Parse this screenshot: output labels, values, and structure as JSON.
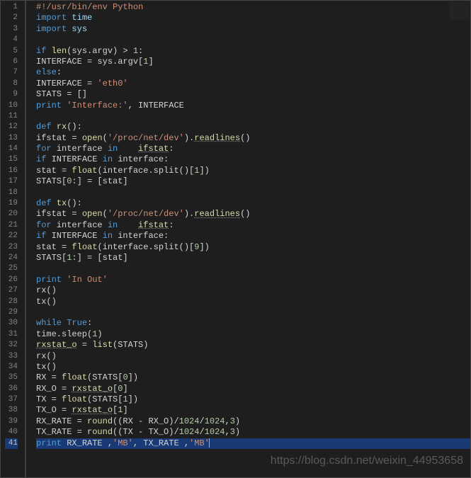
{
  "watermark": "https://blog.csdn.net/weixin_44953658",
  "active_line": 41,
  "lines": [
    {
      "n": 1,
      "tokens": [
        [
          "#!/usr/bin/env Python",
          "str"
        ]
      ]
    },
    {
      "n": 2,
      "tokens": [
        [
          "import",
          "kw"
        ],
        [
          " time",
          "var"
        ]
      ]
    },
    {
      "n": 3,
      "tokens": [
        [
          "import",
          "kw"
        ],
        [
          " sys",
          "var"
        ]
      ]
    },
    {
      "n": 4,
      "tokens": []
    },
    {
      "n": 5,
      "tokens": [
        [
          "if",
          "kw"
        ],
        [
          " ",
          "op"
        ],
        [
          "len",
          "fn"
        ],
        [
          "(sys.argv) > ",
          "op"
        ],
        [
          "1",
          "num"
        ],
        [
          ":",
          "op"
        ]
      ]
    },
    {
      "n": 6,
      "tokens": [
        [
          "INTERFACE = sys.argv[",
          "op"
        ],
        [
          "1",
          "num"
        ],
        [
          "]",
          "op"
        ]
      ]
    },
    {
      "n": 7,
      "tokens": [
        [
          "else",
          "kw"
        ],
        [
          ":",
          "op"
        ]
      ]
    },
    {
      "n": 8,
      "tokens": [
        [
          "INTERFACE = ",
          "op"
        ],
        [
          "'eth0'",
          "str"
        ]
      ]
    },
    {
      "n": 9,
      "tokens": [
        [
          "STATS = []",
          "op"
        ]
      ]
    },
    {
      "n": 10,
      "tokens": [
        [
          "print",
          "kw"
        ],
        [
          " ",
          "op"
        ],
        [
          "'Interface:'",
          "str"
        ],
        [
          ", INTERFACE",
          "op"
        ]
      ]
    },
    {
      "n": 11,
      "tokens": []
    },
    {
      "n": 12,
      "tokens": [
        [
          "def",
          "kw"
        ],
        [
          " ",
          "op"
        ],
        [
          "rx",
          "fn"
        ],
        [
          "():",
          "op"
        ]
      ]
    },
    {
      "n": 13,
      "tokens": [
        [
          "ifstat = ",
          "op"
        ],
        [
          "open",
          "fn"
        ],
        [
          "(",
          "op"
        ],
        [
          "'/proc/net/dev'",
          "str"
        ],
        [
          ").",
          "op"
        ],
        [
          "readlines",
          "fn ul"
        ],
        [
          "()",
          "op"
        ]
      ]
    },
    {
      "n": 14,
      "tokens": [
        [
          "for",
          "kw"
        ],
        [
          " interface ",
          "op"
        ],
        [
          "in",
          "kw"
        ],
        [
          "    ",
          "op"
        ],
        [
          "ifstat",
          "fn ul"
        ],
        [
          ":",
          "op"
        ]
      ]
    },
    {
      "n": 15,
      "tokens": [
        [
          "if",
          "kw"
        ],
        [
          " INTERFACE ",
          "op"
        ],
        [
          "in",
          "kw"
        ],
        [
          " interface:",
          "op"
        ]
      ]
    },
    {
      "n": 16,
      "tokens": [
        [
          "stat = ",
          "op"
        ],
        [
          "float",
          "fn"
        ],
        [
          "(interface.split()[",
          "op"
        ],
        [
          "1",
          "num"
        ],
        [
          "])",
          "op"
        ]
      ]
    },
    {
      "n": 17,
      "tokens": [
        [
          "STATS[",
          "op"
        ],
        [
          "0",
          "num"
        ],
        [
          ":] = [stat]",
          "op"
        ]
      ]
    },
    {
      "n": 18,
      "tokens": []
    },
    {
      "n": 19,
      "tokens": [
        [
          "def",
          "kw"
        ],
        [
          " ",
          "op"
        ],
        [
          "tx",
          "fn"
        ],
        [
          "():",
          "op"
        ]
      ]
    },
    {
      "n": 20,
      "tokens": [
        [
          "ifstat = ",
          "op"
        ],
        [
          "open",
          "fn"
        ],
        [
          "(",
          "op"
        ],
        [
          "'/proc/net/dev'",
          "str"
        ],
        [
          ").",
          "op"
        ],
        [
          "readlines",
          "fn ul"
        ],
        [
          "()",
          "op"
        ]
      ]
    },
    {
      "n": 21,
      "tokens": [
        [
          "for",
          "kw"
        ],
        [
          " interface ",
          "op"
        ],
        [
          "in",
          "kw"
        ],
        [
          "    ",
          "op"
        ],
        [
          "ifstat",
          "fn ul"
        ],
        [
          ":",
          "op"
        ]
      ]
    },
    {
      "n": 22,
      "tokens": [
        [
          "if",
          "kw"
        ],
        [
          " INTERFACE ",
          "op"
        ],
        [
          "in",
          "kw"
        ],
        [
          " interface:",
          "op"
        ]
      ]
    },
    {
      "n": 23,
      "tokens": [
        [
          "stat = ",
          "op"
        ],
        [
          "float",
          "fn"
        ],
        [
          "(interface.split()[",
          "op"
        ],
        [
          "9",
          "num"
        ],
        [
          "])",
          "op"
        ]
      ]
    },
    {
      "n": 24,
      "tokens": [
        [
          "STATS[",
          "op"
        ],
        [
          "1",
          "num"
        ],
        [
          ":] = [stat]",
          "op"
        ]
      ]
    },
    {
      "n": 25,
      "tokens": []
    },
    {
      "n": 26,
      "tokens": [
        [
          "print",
          "kw"
        ],
        [
          " ",
          "op"
        ],
        [
          "'In Out'",
          "str"
        ]
      ]
    },
    {
      "n": 27,
      "tokens": [
        [
          "rx()",
          "op"
        ]
      ]
    },
    {
      "n": 28,
      "tokens": [
        [
          "tx()",
          "op"
        ]
      ]
    },
    {
      "n": 29,
      "tokens": []
    },
    {
      "n": 30,
      "tokens": [
        [
          "while",
          "kw"
        ],
        [
          " ",
          "op"
        ],
        [
          "True",
          "kw"
        ],
        [
          ":",
          "op"
        ]
      ]
    },
    {
      "n": 31,
      "tokens": [
        [
          "time.sleep(",
          "op"
        ],
        [
          "1",
          "num"
        ],
        [
          ")",
          "op"
        ]
      ]
    },
    {
      "n": 32,
      "tokens": [
        [
          "rxstat_o",
          "fn ul"
        ],
        [
          " = ",
          "op"
        ],
        [
          "list",
          "fn"
        ],
        [
          "(STATS)",
          "op"
        ]
      ]
    },
    {
      "n": 33,
      "tokens": [
        [
          "rx()",
          "op"
        ]
      ]
    },
    {
      "n": 34,
      "tokens": [
        [
          "tx()",
          "op"
        ]
      ]
    },
    {
      "n": 35,
      "tokens": [
        [
          "RX = ",
          "op"
        ],
        [
          "float",
          "fn"
        ],
        [
          "(STATS[",
          "op"
        ],
        [
          "0",
          "num"
        ],
        [
          "])",
          "op"
        ]
      ]
    },
    {
      "n": 36,
      "tokens": [
        [
          "RX_O = ",
          "op"
        ],
        [
          "rxstat_o",
          "fn ul"
        ],
        [
          "[",
          "op"
        ],
        [
          "0",
          "num"
        ],
        [
          "]",
          "op"
        ]
      ]
    },
    {
      "n": 37,
      "tokens": [
        [
          "TX = ",
          "op"
        ],
        [
          "float",
          "fn"
        ],
        [
          "(STATS[",
          "op"
        ],
        [
          "1",
          "num"
        ],
        [
          "])",
          "op"
        ]
      ]
    },
    {
      "n": 38,
      "tokens": [
        [
          "TX_O = ",
          "op"
        ],
        [
          "rxstat_o",
          "fn ul"
        ],
        [
          "[",
          "op"
        ],
        [
          "1",
          "num"
        ],
        [
          "]",
          "op"
        ]
      ]
    },
    {
      "n": 39,
      "tokens": [
        [
          "RX_RATE = ",
          "op"
        ],
        [
          "round",
          "fn"
        ],
        [
          "((RX - RX_O)/",
          "op"
        ],
        [
          "1024",
          "num"
        ],
        [
          "/",
          "op"
        ],
        [
          "1024",
          "num"
        ],
        [
          ",",
          "op"
        ],
        [
          "3",
          "num"
        ],
        [
          ")",
          "op"
        ]
      ]
    },
    {
      "n": 40,
      "tokens": [
        [
          "TX_RATE = ",
          "op"
        ],
        [
          "round",
          "fn"
        ],
        [
          "((TX - TX_O)/",
          "op"
        ],
        [
          "1024",
          "num"
        ],
        [
          "/",
          "op"
        ],
        [
          "1024",
          "num"
        ],
        [
          ",",
          "op"
        ],
        [
          "3",
          "num"
        ],
        [
          ")",
          "op"
        ]
      ]
    },
    {
      "n": 41,
      "tokens": [
        [
          "print",
          "kw"
        ],
        [
          " RX_RATE ,",
          "op"
        ],
        [
          "'MB'",
          "str"
        ],
        [
          ", TX_RATE ,",
          "op"
        ],
        [
          "'MB'",
          "str"
        ]
      ]
    }
  ]
}
